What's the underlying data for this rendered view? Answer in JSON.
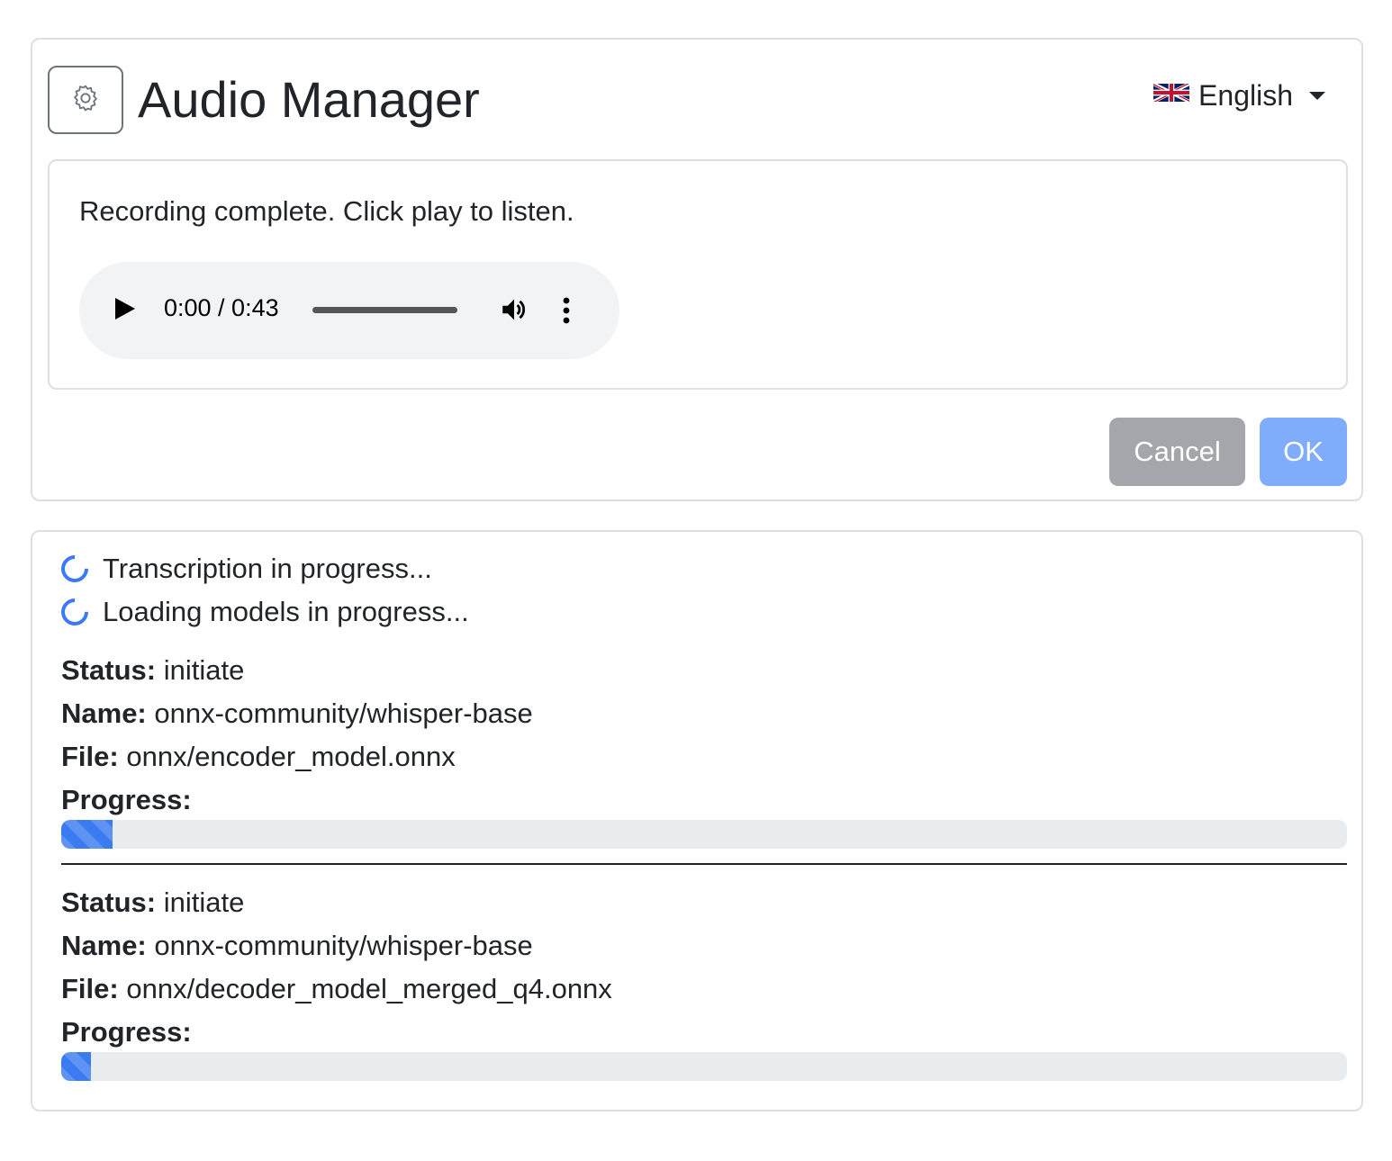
{
  "header": {
    "title": "Audio Manager",
    "settings_icon": "gear-icon",
    "language": {
      "flag_icon": "uk-flag-icon",
      "label": "English"
    }
  },
  "recording": {
    "message": "Recording complete. Click play to listen.",
    "player": {
      "current_time": "0:00",
      "duration": "0:43",
      "time_display": "0:00 / 0:43",
      "icons": [
        "play-icon",
        "volume-icon",
        "more-options-icon"
      ]
    }
  },
  "actions": {
    "cancel_label": "Cancel",
    "ok_label": "OK"
  },
  "progress": {
    "status_lines": [
      "Transcription in progress...",
      "Loading models in progress..."
    ],
    "labels": {
      "status": "Status:",
      "name": "Name:",
      "file": "File:",
      "progress": "Progress:"
    },
    "models": [
      {
        "status": "initiate",
        "name": "onnx-community/whisper-base",
        "file": "onnx/encoder_model.onnx",
        "progress_percent": 4
      },
      {
        "status": "initiate",
        "name": "onnx-community/whisper-base",
        "file": "onnx/decoder_model_merged_q4.onnx",
        "progress_percent": 2.3
      }
    ]
  },
  "colors": {
    "accent": "#3a7bf2",
    "ok_button": "#7fadfc",
    "cancel_button": "#a3a7ab",
    "border": "#dcdfe3",
    "player_bg": "#f1f3f4"
  }
}
